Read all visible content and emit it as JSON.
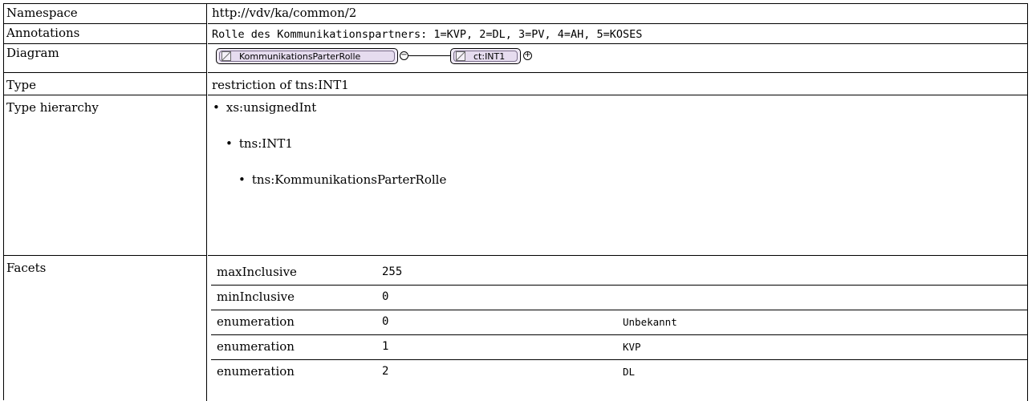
{
  "rows": {
    "namespace": {
      "label": "Namespace",
      "value": "http://vdv/ka/common/2"
    },
    "annotations": {
      "label": "Annotations",
      "value": "Rolle des Kommunikationspartners: 1=KVP, 2=DL, 3=PV, 4=AH, 5=KOSES"
    },
    "diagram": {
      "label": "Diagram",
      "element": "KommunikationsParterRolle",
      "base": "ct:INT1",
      "collapse_symbol": "−",
      "expand_symbol": "+"
    },
    "type": {
      "label": "Type",
      "value": "restriction of tns:INT1"
    },
    "hierarchy": {
      "label": "Type hierarchy",
      "bullet": "•",
      "levels": [
        "xs:unsignedInt",
        "tns:INT1",
        "tns:KommunikationsParterRolle"
      ]
    },
    "facets": {
      "label": "Facets",
      "items": [
        {
          "name": "maxInclusive",
          "value": "255",
          "doc": ""
        },
        {
          "name": "minInclusive",
          "value": "0",
          "doc": ""
        },
        {
          "name": "enumeration",
          "value": "0",
          "doc": "Unbekannt"
        },
        {
          "name": "enumeration",
          "value": "1",
          "doc": "KVP"
        },
        {
          "name": "enumeration",
          "value": "2",
          "doc": "DL"
        }
      ]
    }
  },
  "colors": {
    "diagram_fill": "#f0eaf6",
    "border": "#000000"
  }
}
